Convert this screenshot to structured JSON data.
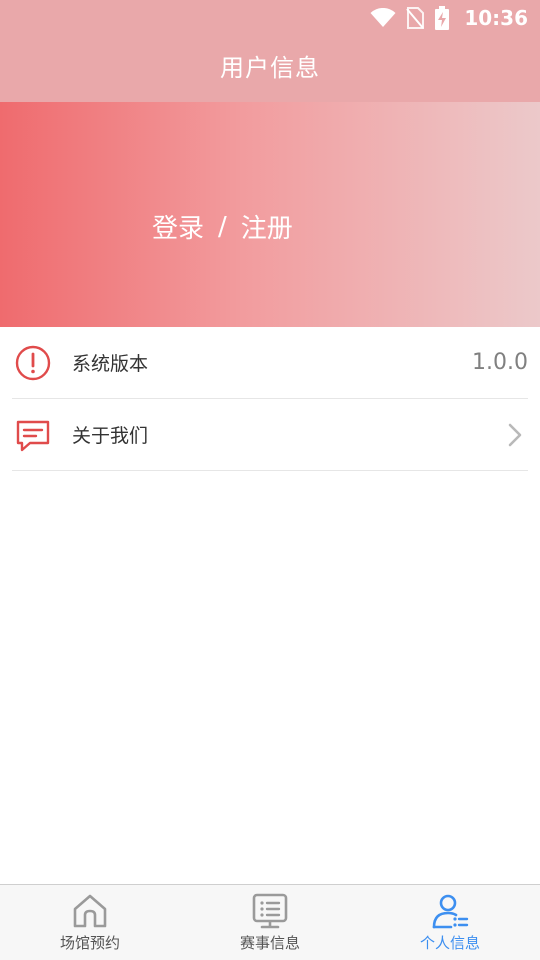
{
  "status_bar": {
    "time": "10:36",
    "icons": [
      "wifi-icon",
      "no-sim-icon",
      "battery-charging-icon"
    ]
  },
  "header": {
    "title": "用户信息"
  },
  "banner": {
    "login_label": "登录",
    "separator": "/",
    "register_label": "注册"
  },
  "list": {
    "items": [
      {
        "icon": "alert-circle-icon",
        "label": "系统版本",
        "value": "1.0.0"
      },
      {
        "icon": "message-icon",
        "label": "关于我们"
      }
    ]
  },
  "bottom_nav": {
    "items": [
      {
        "icon": "home-icon",
        "label": "场馆预约"
      },
      {
        "icon": "list-board-icon",
        "label": "赛事信息"
      },
      {
        "icon": "user-list-icon",
        "label": "个人信息",
        "active": true
      }
    ]
  },
  "colors": {
    "header_bg": "#e9a8aa",
    "banner_gradient_start": "#ef6b6e",
    "banner_gradient_end": "#ecc9ca",
    "icon_red": "#e04b4b",
    "nav_active": "#3d8ff0",
    "nav_inactive": "#9a9a9a"
  }
}
